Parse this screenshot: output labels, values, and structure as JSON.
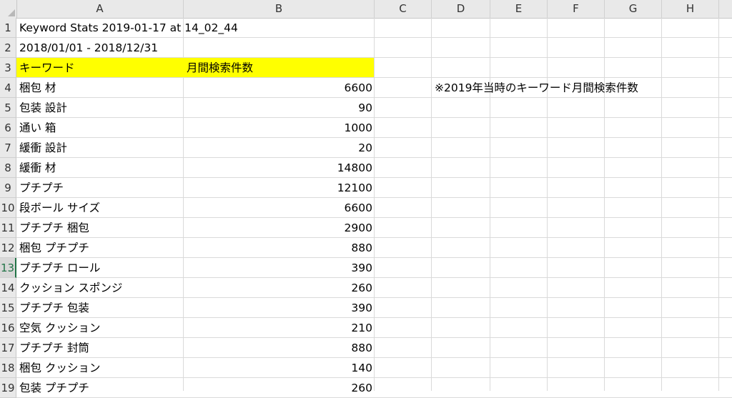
{
  "columns": [
    "A",
    "B",
    "C",
    "D",
    "E",
    "F",
    "G",
    "H"
  ],
  "rows": [
    "1",
    "2",
    "3",
    "4",
    "5",
    "6",
    "7",
    "8",
    "9",
    "10",
    "11",
    "12",
    "13",
    "14",
    "15",
    "16",
    "17",
    "18",
    "19"
  ],
  "active_row": "13",
  "title_line": "Keyword Stats 2019-01-17 at 14_02_44",
  "date_range": "2018/01/01 - 2018/12/31",
  "headers": {
    "keyword": "キーワード",
    "monthly": "月間検索件数"
  },
  "header_highlight_color": "#ffff00",
  "note": "※2019年当時のキーワード月間検索件数",
  "data": [
    {
      "keyword": "梱包 材",
      "value": "6600"
    },
    {
      "keyword": "包装 設計",
      "value": "90"
    },
    {
      "keyword": "通い 箱",
      "value": "1000"
    },
    {
      "keyword": "緩衝 設計",
      "value": "20"
    },
    {
      "keyword": "緩衝 材",
      "value": "14800"
    },
    {
      "keyword": "プチプチ",
      "value": "12100"
    },
    {
      "keyword": "段ボール サイズ",
      "value": "6600"
    },
    {
      "keyword": "プチプチ 梱包",
      "value": "2900"
    },
    {
      "keyword": "梱包 プチプチ",
      "value": "880"
    },
    {
      "keyword": "プチプチ ロール",
      "value": "390"
    },
    {
      "keyword": "クッション スポンジ",
      "value": "260"
    },
    {
      "keyword": "プチプチ 包装",
      "value": "390"
    },
    {
      "keyword": "空気 クッション",
      "value": "210"
    },
    {
      "keyword": "プチプチ 封筒",
      "value": "880"
    },
    {
      "keyword": "梱包 クッション",
      "value": "140"
    },
    {
      "keyword": "包装 プチプチ",
      "value": "260"
    }
  ]
}
